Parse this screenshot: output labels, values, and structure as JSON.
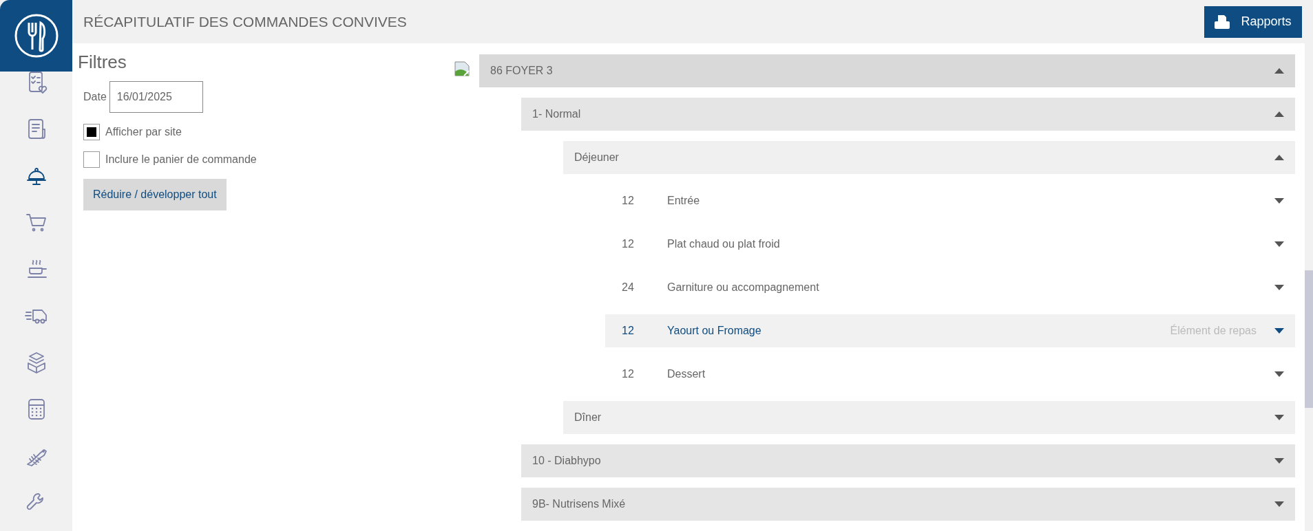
{
  "sidebar": {
    "items": [
      {
        "selected": false
      },
      {
        "selected": false
      },
      {
        "selected": true
      },
      {
        "selected": false
      },
      {
        "selected": false
      },
      {
        "selected": false
      },
      {
        "selected": false
      },
      {
        "selected": false
      },
      {
        "selected": false
      },
      {
        "selected": false
      }
    ]
  },
  "header": {
    "title": "RÉCAPITULATIF DES COMMANDES CONVIVES",
    "reports_button": "Rapports"
  },
  "filters": {
    "title": "Filtres",
    "date_label": "Date",
    "date_value": "16/01/2025",
    "checkboxes": [
      {
        "label": "Afficher par site",
        "checked": true
      },
      {
        "label": "Inclure le panier de commande",
        "checked": false
      }
    ],
    "toggle_button": "Réduire / développer tout"
  },
  "tree": [
    {
      "kind": "group",
      "label": "86 FOYER 3",
      "expanded": true,
      "children": [
        {
          "kind": "group",
          "label": "1- Normal",
          "expanded": true,
          "children": [
            {
              "kind": "group",
              "label": "Déjeuner",
              "expanded": true,
              "children": [
                {
                  "kind": "item",
                  "count": "12",
                  "label": "Entrée",
                  "selected": false,
                  "expanded": false
                },
                {
                  "kind": "item",
                  "count": "12",
                  "label": "Plat chaud ou plat froid",
                  "selected": false,
                  "expanded": false
                },
                {
                  "kind": "item",
                  "count": "24",
                  "label": "Garniture ou accompagnement",
                  "selected": false,
                  "expanded": false
                },
                {
                  "kind": "item",
                  "count": "12",
                  "label": "Yaourt ou Fromage",
                  "selected": true,
                  "expanded": false,
                  "hint": "Élément de repas"
                },
                {
                  "kind": "item",
                  "count": "12",
                  "label": "Dessert",
                  "selected": false,
                  "expanded": false
                }
              ]
            },
            {
              "kind": "group",
              "label": "Dîner",
              "expanded": false
            }
          ]
        },
        {
          "kind": "group",
          "label": "10 - Diabhypo",
          "expanded": false
        },
        {
          "kind": "group",
          "label": "9B- Nutrisens Mixé",
          "expanded": false
        }
      ]
    }
  ]
}
